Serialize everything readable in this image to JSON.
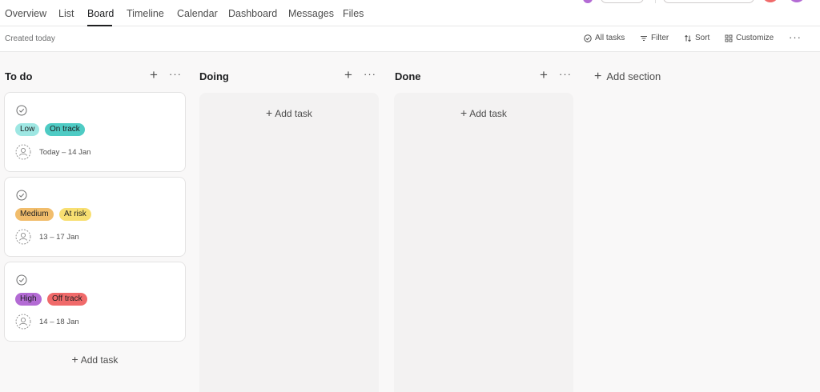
{
  "tabs": [
    {
      "label": "Overview"
    },
    {
      "label": "List"
    },
    {
      "label": "Board",
      "active": true
    },
    {
      "label": "Timeline"
    },
    {
      "label": "Calendar"
    },
    {
      "label": "Dashboard"
    },
    {
      "label": "Messages"
    },
    {
      "label": "Files"
    }
  ],
  "toolbar": {
    "created": "Created today",
    "all_tasks": "All tasks",
    "filter": "Filter",
    "sort": "Sort",
    "customize": "Customize",
    "more": "···"
  },
  "columns": [
    {
      "title": "To do",
      "add_task": "Add task"
    },
    {
      "title": "Doing",
      "add_task": "Add task"
    },
    {
      "title": "Done",
      "add_task": "Add task"
    }
  ],
  "column_controls": {
    "plus": "+",
    "more": "···"
  },
  "add_section": "Add section",
  "add_plus": "+",
  "cards": [
    {
      "priority": "Low",
      "status": "On track",
      "date": "Today – 14 Jan"
    },
    {
      "priority": "Medium",
      "status": "At risk",
      "date": "13 – 17 Jan"
    },
    {
      "priority": "High",
      "status": "Off track",
      "date": "14 – 18 Jan"
    }
  ],
  "colors": {
    "low": "#9ee7e3",
    "on_track": "#4ecbc4",
    "medium": "#f1bd6c",
    "at_risk": "#f8df72",
    "high": "#b36bd4",
    "off_track": "#f06a6a"
  }
}
